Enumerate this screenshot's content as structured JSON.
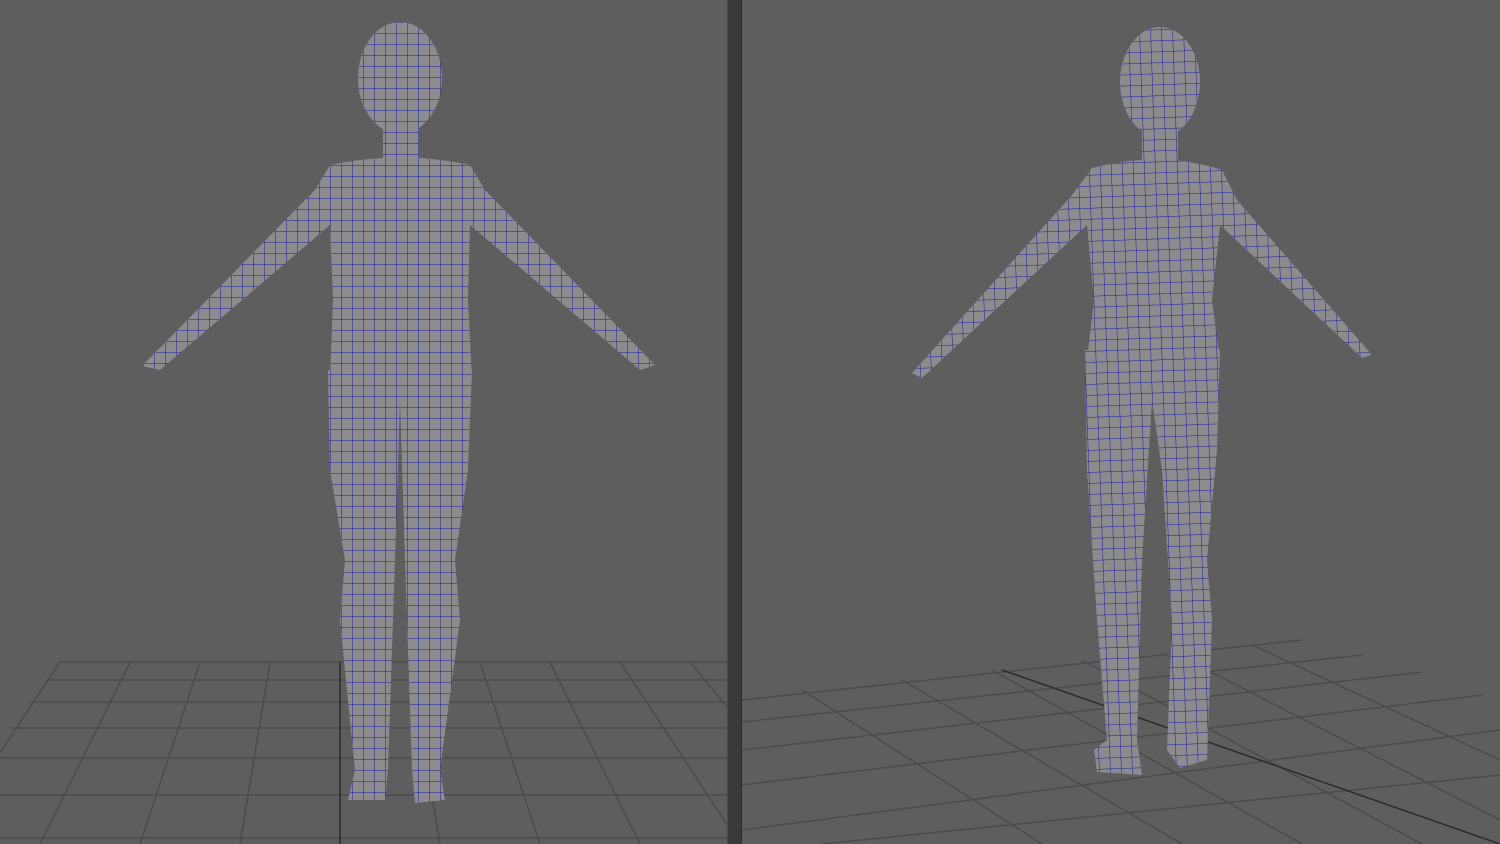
{
  "colors": {
    "viewport_bg": "#5e5e5e",
    "divider": "#3a3a3a",
    "grid_line": "#4b4b4b",
    "grid_axis": "#2a2a2a",
    "mesh_fill": "#8c8c8e",
    "wire": "#1c1ca0"
  },
  "viewports": [
    {
      "view": "front",
      "icon": "wireframe-character-front"
    },
    {
      "view": "back",
      "icon": "wireframe-character-back"
    }
  ]
}
